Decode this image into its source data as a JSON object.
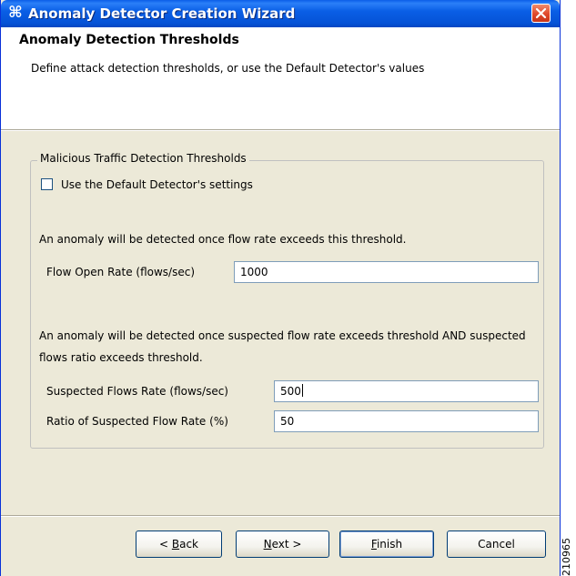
{
  "window": {
    "title": "Anomaly Detector Creation Wizard",
    "app_icon": "⌘"
  },
  "header": {
    "title": "Anomaly Detection Thresholds",
    "description": "Define attack detection thresholds, or use the Default Detector's values"
  },
  "group": {
    "title": "Malicious Traffic Detection Thresholds",
    "use_default_label": "Use the Default Detector's settings",
    "use_default_checked": false,
    "flow_description": "An anomaly will be detected once flow rate exceeds this threshold.",
    "flow_open_rate_label": "Flow Open Rate (flows/sec)",
    "flow_open_rate_value": "1000",
    "suspected_description": "An anomaly will be detected once suspected flow rate exceeds threshold AND suspected flows ratio exceeds threshold.",
    "suspected_rate_label": "Suspected Flows Rate (flows/sec)",
    "suspected_rate_value": "500",
    "ratio_label": "Ratio of Suspected Flow Rate (%)",
    "ratio_value": "50"
  },
  "buttons": {
    "back_mnemonic": "B",
    "back_rest": "ack",
    "back_prefix": "< ",
    "next_mnemonic": "N",
    "next_rest": "ext >",
    "finish_mnemonic": "F",
    "finish_rest": "inish",
    "cancel_label": "Cancel"
  },
  "figure_id": "210965",
  "colors": {
    "titlebar": "#0a5fe6",
    "close": "#e0482b",
    "dialog_bg": "#ece9d8"
  }
}
